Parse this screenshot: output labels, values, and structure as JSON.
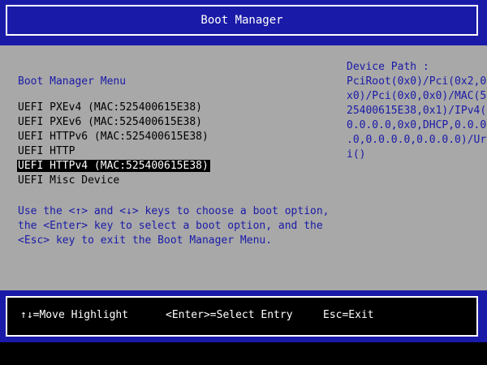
{
  "header": {
    "title": "Boot Manager"
  },
  "menu": {
    "heading": "Boot Manager Menu",
    "options": [
      "UEFI PXEv4 (MAC:525400615E38)",
      "UEFI PXEv6 (MAC:525400615E38)",
      "UEFI HTTPv6 (MAC:525400615E38)",
      "UEFI HTTP",
      "UEFI HTTPv4 (MAC:525400615E38)",
      "UEFI Misc Device"
    ],
    "selected_index": 4
  },
  "help": {
    "lines": [
      "Use the <↑> and <↓> keys to choose a boot option,",
      "the <Enter> key to select a boot option, and the",
      "<Esc> key to exit the Boot Manager Menu."
    ]
  },
  "device_path": {
    "lines": [
      "Device Path :",
      "PciRoot(0x0)/Pci(0x2,0",
      "x0)/Pci(0x0,0x0)/MAC(5",
      "25400615E38,0x1)/IPv4(",
      "0.0.0.0,0x0,DHCP,0.0.0",
      ".0,0.0.0.0,0.0.0.0)/Ur",
      "i()"
    ]
  },
  "footer": {
    "move_hint": "↑↓=Move Highlight",
    "enter_hint": "<Enter>=Select Entry",
    "esc_hint": "Esc=Exit"
  },
  "colors": {
    "frame_blue": "#1a1aa8",
    "panel_gray": "#a8a8a8",
    "text_blue": "#1a1aa8",
    "highlight_bg": "#000000",
    "highlight_fg": "#ffffff"
  }
}
